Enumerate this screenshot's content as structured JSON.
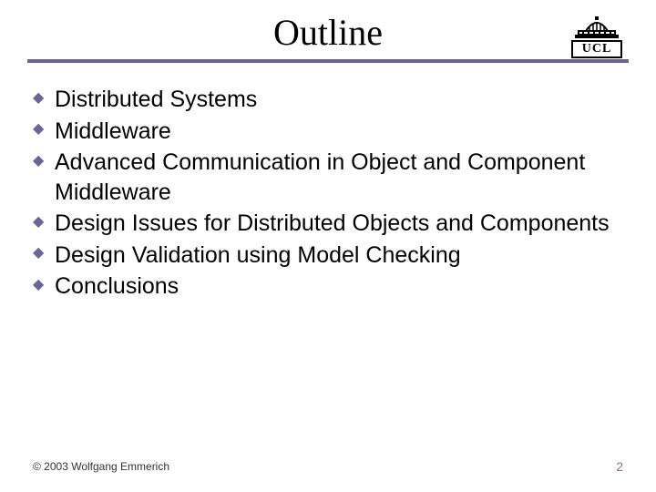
{
  "title": "Outline",
  "logo_text": "UCL",
  "bullets": [
    "Distributed Systems",
    "Middleware",
    "Advanced Communication in Object and Component Middleware",
    "Design Issues for Distributed Objects and Components",
    "Design Validation using Model Checking",
    "Conclusions"
  ],
  "copyright": "© 2003 Wolfgang Emmerich",
  "page_number": "2"
}
